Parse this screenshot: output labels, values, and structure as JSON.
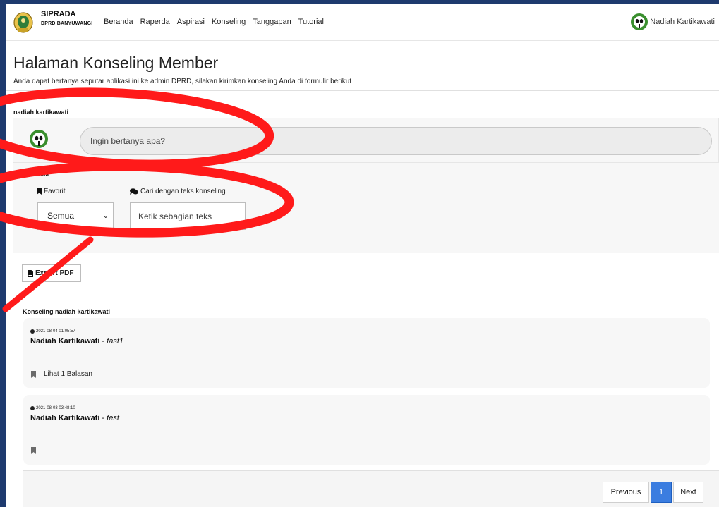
{
  "navbar": {
    "brand_name": "SIPRADA",
    "brand_sub": "DPRD BANYUWANGI",
    "links": [
      "Beranda",
      "Raperda",
      "Aspirasi",
      "Konseling",
      "Tanggapan",
      "Tutorial"
    ],
    "user_name": "Nadiah Kartikawati"
  },
  "page": {
    "title": "Halaman Konseling Member",
    "description": "Anda dapat bertanya seputar aplikasi ini ke admin DPRD, silakan kirimkan konseling Anda di formulir berikut"
  },
  "ask": {
    "section_name": "nadiah kartikawati",
    "placeholder": "Ingin bertanya apa?"
  },
  "filter": {
    "title": "Filter Data",
    "favorite_label": "Favorit",
    "favorite_value": "Semua",
    "search_label": "Cari dengan teks konseling",
    "search_placeholder": "Ketik sebagian teks"
  },
  "export_label": "Export PDF",
  "list": {
    "title": "Konseling nadiah kartikawati",
    "items": [
      {
        "time": "2021-08-04 01:05:57",
        "author": "Nadiah Kartikawati",
        "separator": " - ",
        "message": "tast1",
        "reply_label": "Lihat 1 Balasan"
      },
      {
        "time": "2021-08-03 03:48:10",
        "author": "Nadiah Kartikawati",
        "separator": " - ",
        "message": "test",
        "reply_label": ""
      }
    ]
  },
  "pagination": {
    "previous": "Previous",
    "current": "1",
    "next": "Next"
  },
  "colors": {
    "accent": "#3b7de0",
    "annotation": "#ff1a1a",
    "frame": "#1e3a6e"
  }
}
